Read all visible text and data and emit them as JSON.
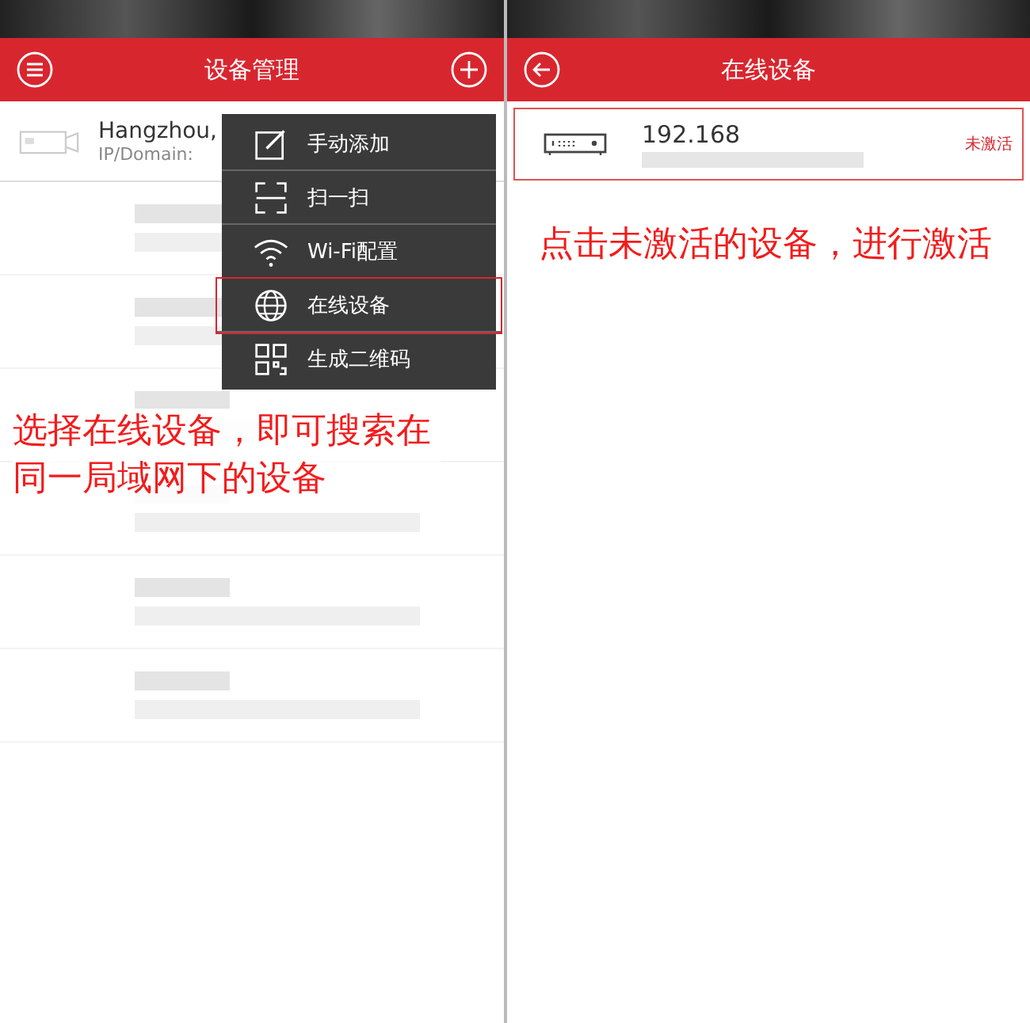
{
  "left_screen": {
    "header": {
      "title": "设备管理"
    },
    "devices": [
      {
        "title": "Hangzhou,",
        "subtitle": "IP/Domain:"
      }
    ],
    "menu": {
      "items": [
        {
          "kind": "edit",
          "label": "手动添加",
          "selected": false
        },
        {
          "kind": "scan",
          "label": "扫一扫",
          "selected": false
        },
        {
          "kind": "wifi",
          "label": "Wi-Fi配置",
          "selected": false
        },
        {
          "kind": "globe",
          "label": "在线设备",
          "selected": true
        },
        {
          "kind": "qr",
          "label": "生成二维码",
          "selected": false
        }
      ]
    },
    "caption": "选择在线设备，即可搜索在同一局域网下的设备"
  },
  "right_screen": {
    "header": {
      "title": "在线设备"
    },
    "devices": [
      {
        "ip": "192.168",
        "status": "未激活",
        "selected": true
      }
    ],
    "caption": "点击未激活的设备，进行激活"
  }
}
